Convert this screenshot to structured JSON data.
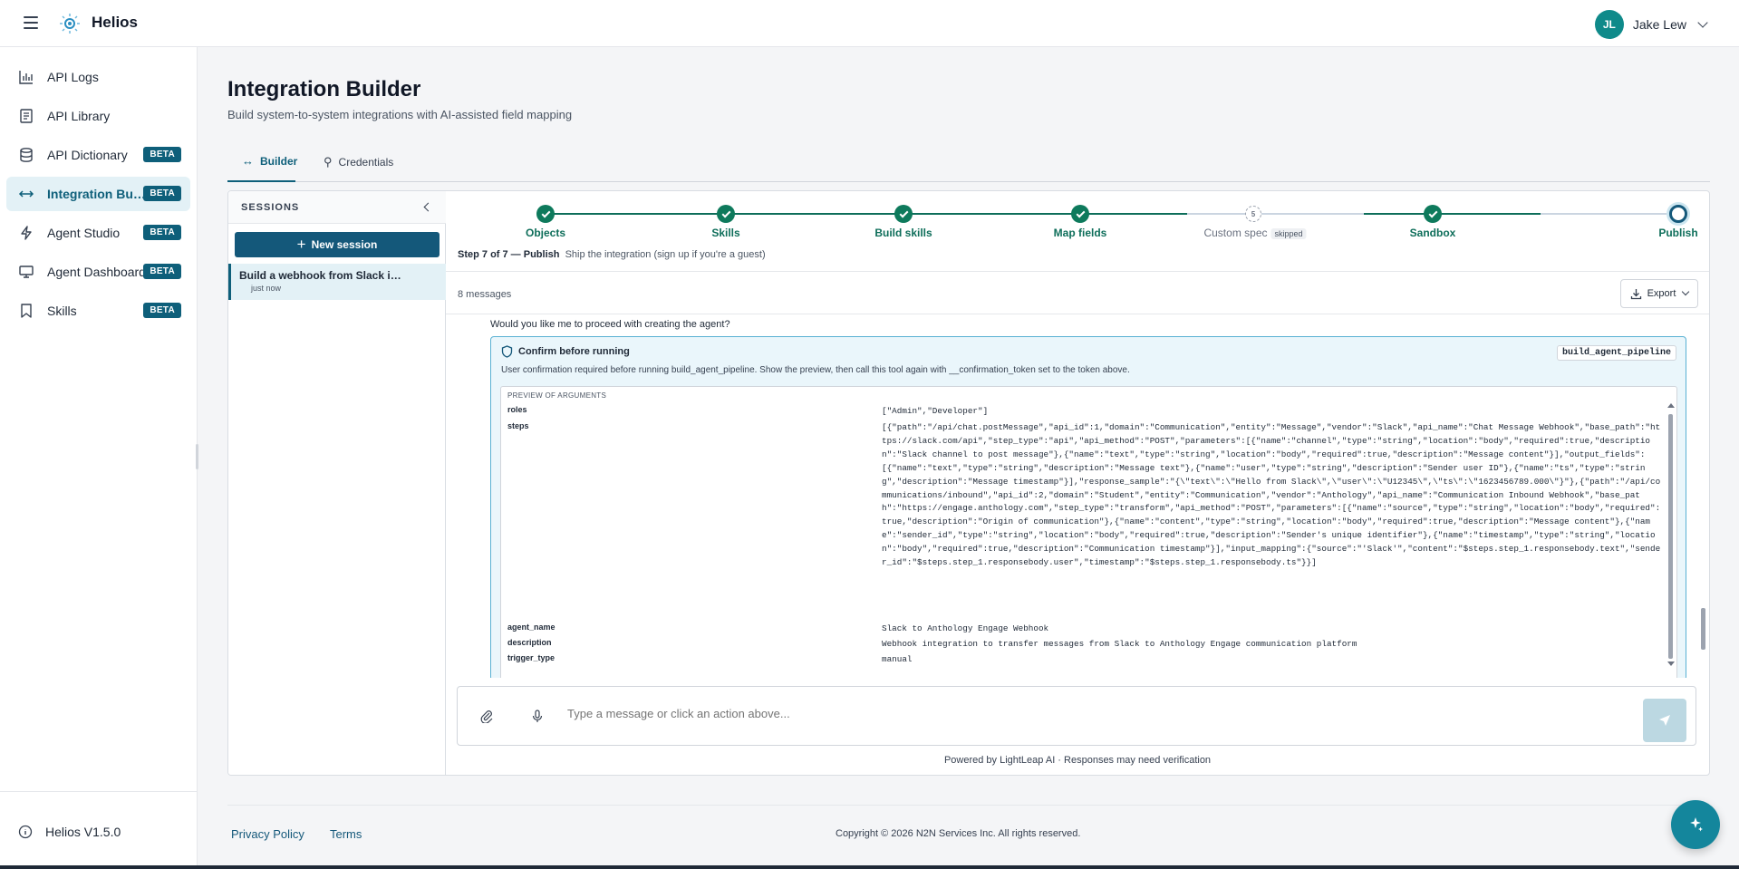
{
  "app": {
    "name": "Helios",
    "version": "Helios V1.5.0"
  },
  "user": {
    "initials": "JL",
    "name": "Jake Lew"
  },
  "sidebar": {
    "items": [
      {
        "label": "API Logs",
        "icon": "bar-chart-icon",
        "beta": ""
      },
      {
        "label": "API Library",
        "icon": "book-icon",
        "beta": ""
      },
      {
        "label": "API Dictionary",
        "icon": "database-icon",
        "beta": "BETA"
      },
      {
        "label": "Integration Builder",
        "icon": "arrows-horizontal-icon",
        "beta": "BETA",
        "active": true
      },
      {
        "label": "Agent Studio",
        "icon": "lightning-icon",
        "beta": "BETA"
      },
      {
        "label": "Agent Dashboard",
        "icon": "monitor-icon",
        "beta": "BETA"
      },
      {
        "label": "Skills",
        "icon": "bookmark-icon",
        "beta": "BETA"
      }
    ]
  },
  "page": {
    "title": "Integration Builder",
    "subtitle": "Build system-to-system integrations with AI-assisted field mapping",
    "tabs": [
      {
        "label": "Builder",
        "active": true
      },
      {
        "label": "Credentials"
      }
    ]
  },
  "sessions": {
    "header": "SESSIONS",
    "new_label": "New session",
    "items": [
      {
        "name": "Build a webhook from Slack integration",
        "time": "just now"
      }
    ]
  },
  "stepper": {
    "steps": [
      {
        "label": "Objects",
        "state": "done"
      },
      {
        "label": "Skills",
        "state": "done"
      },
      {
        "label": "Build skills",
        "state": "done"
      },
      {
        "label": "Map fields",
        "state": "done"
      },
      {
        "label": "Custom spec",
        "state": "skipped",
        "number": "5",
        "tag": "skipped"
      },
      {
        "label": "Sandbox",
        "state": "done"
      },
      {
        "label": "Publish",
        "state": "current"
      }
    ],
    "info_bold": "Step 7 of 7 — Publish",
    "info_text": "Ship the integration (sign up if you're a guest)"
  },
  "messages": {
    "count": "8 messages",
    "export_label": "Export",
    "question": "Would you like me to proceed with creating the agent?"
  },
  "confirm": {
    "title": "Confirm before running",
    "tool": "build_agent_pipeline",
    "description": "User confirmation required before running build_agent_pipeline. Show the preview, then call this tool again with __confirmation_token set to the token above.",
    "preview_label": "PREVIEW OF ARGUMENTS",
    "args": [
      {
        "key": "roles",
        "value": "[\"Admin\",\"Developer\"]"
      },
      {
        "key": "steps",
        "value": "[{\"path\":\"/api/chat.postMessage\",\"api_id\":1,\"domain\":\"Communication\",\"entity\":\"Message\",\"vendor\":\"Slack\",\"api_name\":\"Chat Message Webhook\",\"base_path\":\"https://slack.com/api\",\"step_type\":\"api\",\"api_method\":\"POST\",\"parameters\":[{\"name\":\"channel\",\"type\":\"string\",\"location\":\"body\",\"required\":true,\"description\":\"Slack channel to post message\"},{\"name\":\"text\",\"type\":\"string\",\"location\":\"body\",\"required\":true,\"description\":\"Message content\"}],\"output_fields\":[{\"name\":\"text\",\"type\":\"string\",\"description\":\"Message text\"},{\"name\":\"user\",\"type\":\"string\",\"description\":\"Sender user ID\"},{\"name\":\"ts\",\"type\":\"string\",\"description\":\"Message timestamp\"}],\"response_sample\":\"{\\\"text\\\":\\\"Hello from Slack\\\",\\\"user\\\":\\\"U12345\\\",\\\"ts\\\":\\\"1623456789.000\\\"}\"},{\"path\":\"/api/communications/inbound\",\"api_id\":2,\"domain\":\"Student\",\"entity\":\"Communication\",\"vendor\":\"Anthology\",\"api_name\":\"Communication Inbound Webhook\",\"base_path\":\"https://engage.anthology.com\",\"step_type\":\"transform\",\"api_method\":\"POST\",\"parameters\":[{\"name\":\"source\",\"type\":\"string\",\"location\":\"body\",\"required\":true,\"description\":\"Origin of communication\"},{\"name\":\"content\",\"type\":\"string\",\"location\":\"body\",\"required\":true,\"description\":\"Message content\"},{\"name\":\"sender_id\",\"type\":\"string\",\"location\":\"body\",\"required\":true,\"description\":\"Sender's unique identifier\"},{\"name\":\"timestamp\",\"type\":\"string\",\"location\":\"body\",\"required\":true,\"description\":\"Communication timestamp\"}],\"input_mapping\":{\"source\":\"'Slack'\",\"content\":\"$steps.step_1.responsebody.text\",\"sender_id\":\"$steps.step_1.responsebody.user\",\"timestamp\":\"$steps.step_1.responsebody.ts\"}}]"
      },
      {
        "key": "agent_name",
        "value": "Slack to Anthology Engage Webhook"
      },
      {
        "key": "description",
        "value": "Webhook integration to transfer messages from Slack to Anthology Engage communication platform"
      },
      {
        "key": "trigger_type",
        "value": "manual"
      }
    ]
  },
  "composer": {
    "placeholder": "Type a message or click an action above..."
  },
  "powered": "Powered by LightLeap AI · Responses may need verification",
  "footer": {
    "privacy": "Privacy Policy",
    "terms": "Terms",
    "copyright": "Copyright © 2026 N2N Services Inc. All rights reserved."
  },
  "colors": {
    "primary": "#14587a",
    "success": "#0e7a5c",
    "accent_bg": "#e3f1f6"
  }
}
